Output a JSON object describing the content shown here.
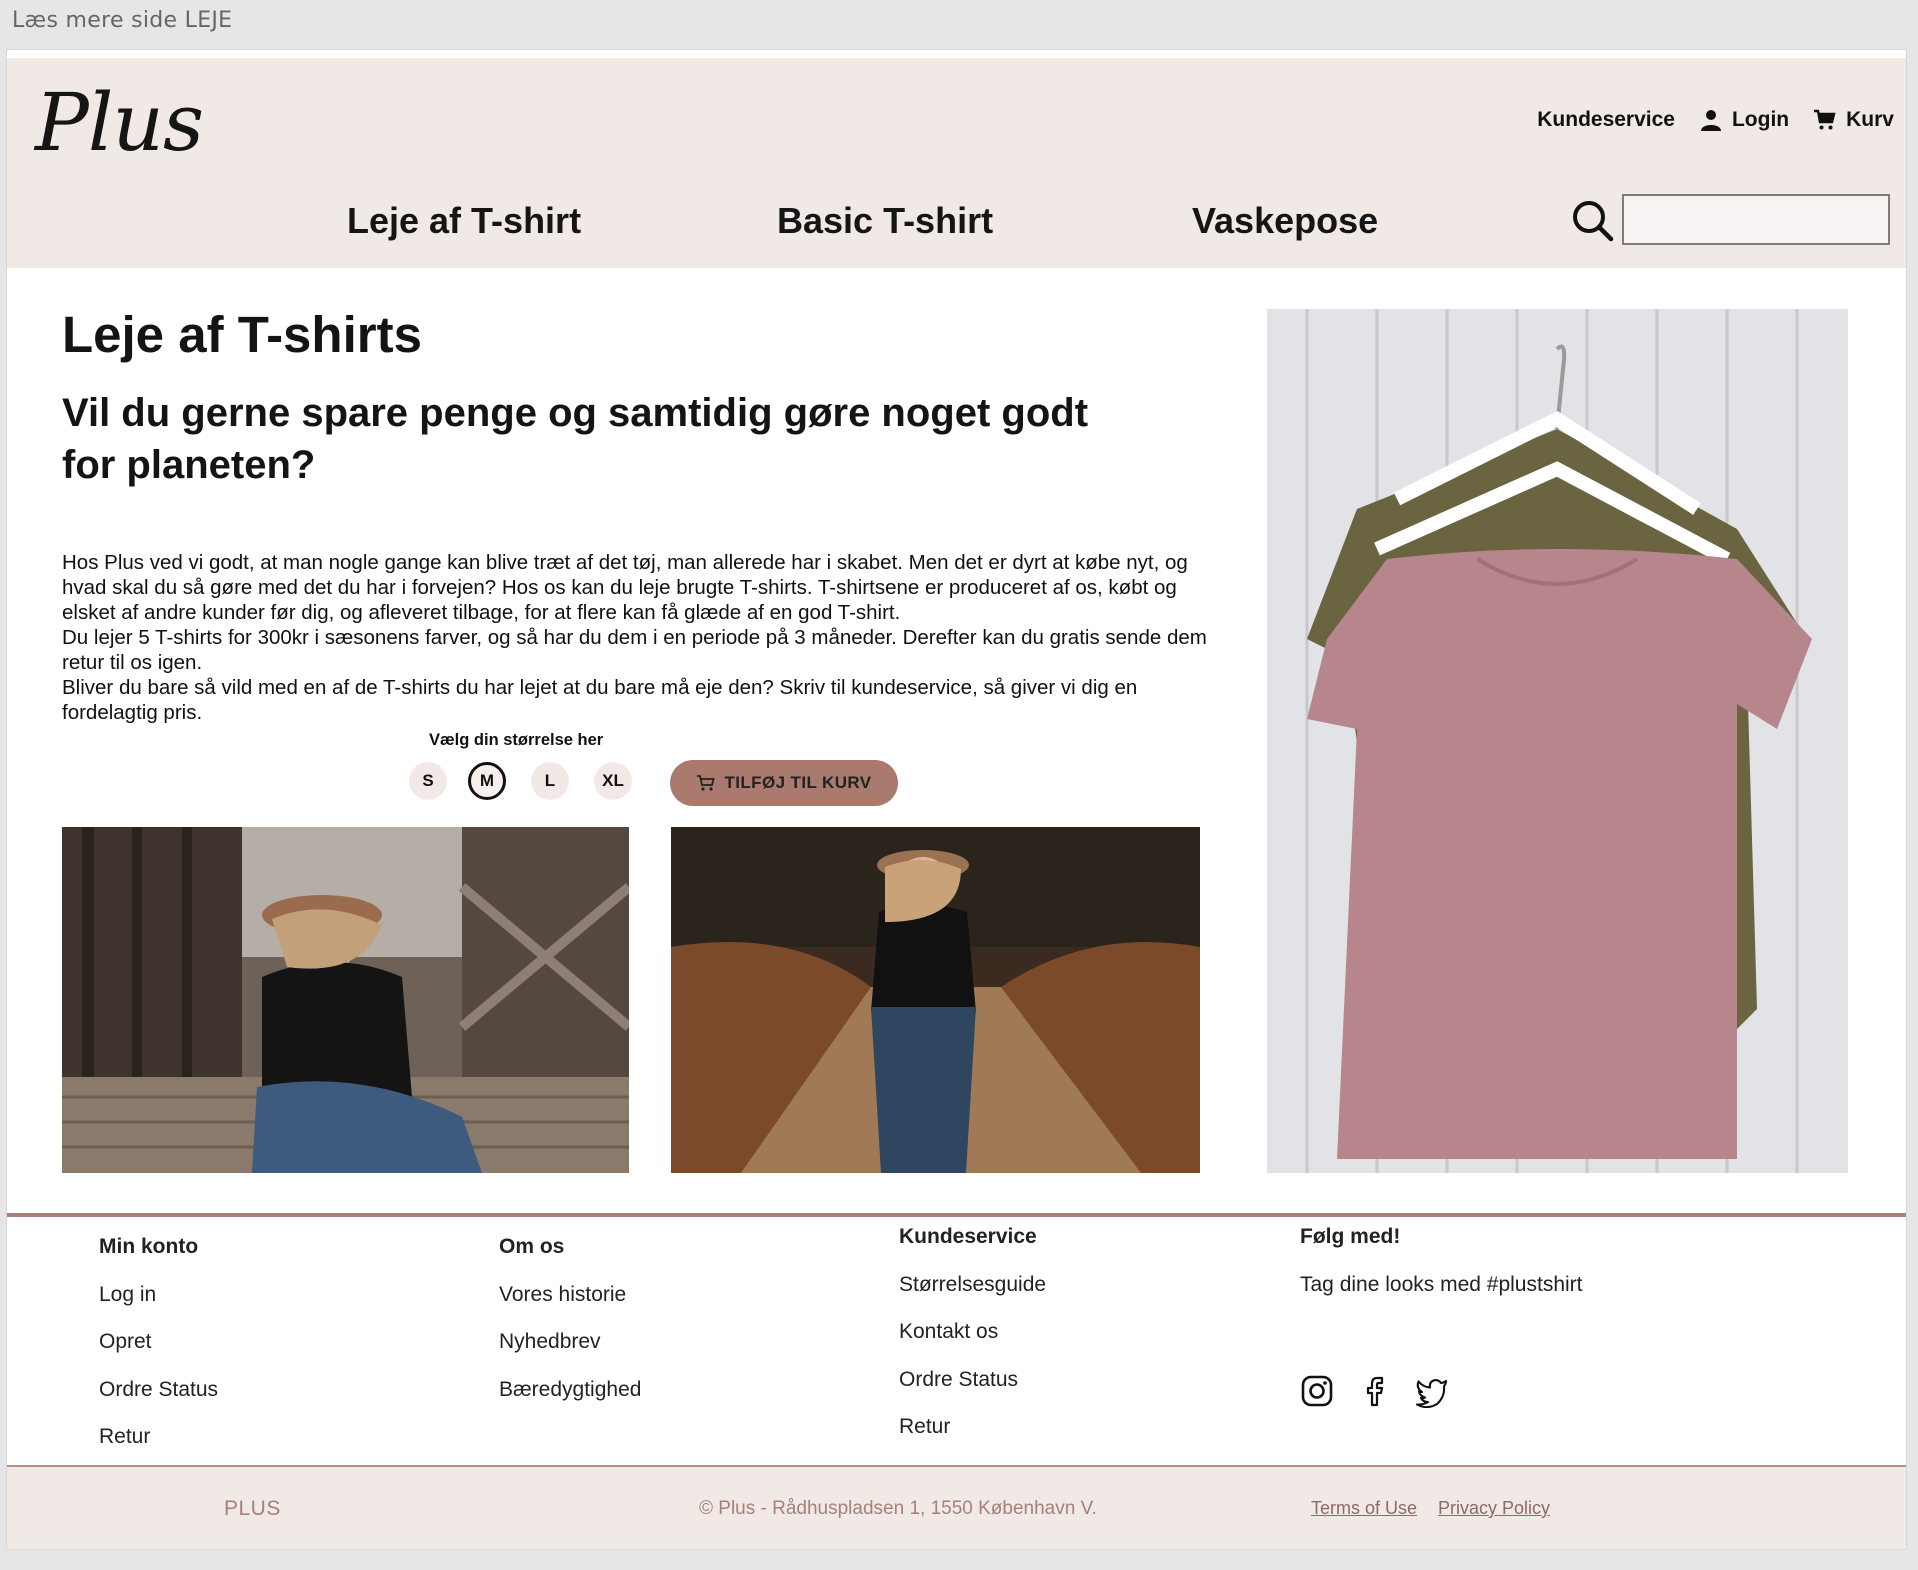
{
  "browser": {
    "tab_title": "Læs mere side LEJE"
  },
  "header": {
    "logo": "Plus",
    "util_nav": {
      "customer_service": "Kundeservice",
      "login": "Login",
      "cart": "Kurv"
    },
    "main_nav": [
      "Leje af T-shirt",
      "Basic T-shirt",
      "Vaskepose"
    ],
    "search": {
      "value": "",
      "placeholder": ""
    }
  },
  "main": {
    "title": "Leje af T-shirts",
    "subtitle": "Vil du gerne spare penge og samtidig gøre noget godt for planeten?",
    "paragraphs": [
      "Hos Plus ved vi godt, at man nogle gange kan blive træt af det tøj, man allerede har i skabet. Men det er dyrt at købe nyt, og hvad skal du så gøre med det du har i forvejen? Hos os kan du leje brugte T-shirts. T-shirtsene er produceret af os, købt og elsket af andre kunder før dig, og afleveret tilbage, for at flere kan få glæde af en god T-shirt.",
      "Du lejer 5 T-shirts for 300kr i sæsonens farver, og så har du dem i en periode på 3 måneder. Derefter kan du gratis sende dem retur til os igen.",
      "Bliver du bare så vild med en af de T-shirts du har lejet at du bare må eje den? Skriv til kundeservice, så giver vi dig en fordelagtig pris."
    ],
    "size_label": "Vælg din størrelse her",
    "sizes": [
      "S",
      "M",
      "L",
      "XL"
    ],
    "selected_size": "M",
    "add_to_cart": "TILFØJ TIL KURV"
  },
  "footer": {
    "columns": [
      {
        "heading": "Min konto",
        "links": [
          "Log in",
          "Opret",
          "Ordre Status",
          "Retur"
        ]
      },
      {
        "heading": "Om os",
        "links": [
          "Vores historie",
          "Nyhedbrev",
          "Bæredygtighed"
        ]
      },
      {
        "heading": "Kundeservice",
        "links": [
          "Størrelsesguide",
          "Kontakt os",
          "Ordre Status",
          "Retur"
        ]
      },
      {
        "heading": "Følg med!",
        "links": [
          "Tag dine looks med #plustshirt"
        ]
      }
    ],
    "social_icons": [
      "instagram-icon",
      "facebook-icon",
      "twitter-icon"
    ],
    "bottom": {
      "brand": "PLUS",
      "copyright": "© Plus - Rådhuspladsen 1, 1550 København V.",
      "terms": "Terms of Use",
      "privacy": "Privacy Policy"
    }
  },
  "colors": {
    "header_bg": "#f1e9e6",
    "accent": "#a97a6d",
    "footer_line": "#a6817a"
  }
}
